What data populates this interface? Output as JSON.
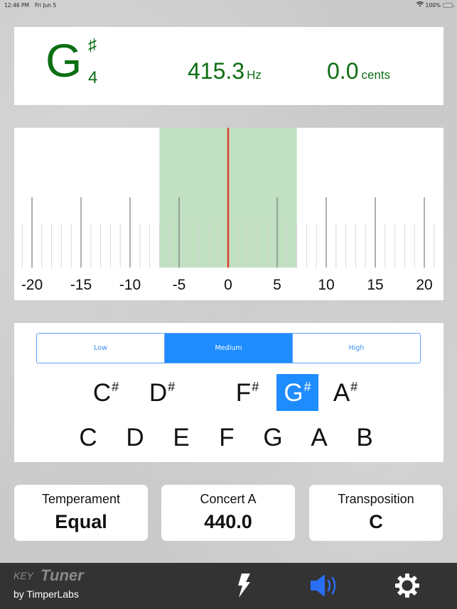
{
  "status_bar": {
    "time": "12:46 PM",
    "date": "Fri Jun 5",
    "battery": "100%",
    "icons": [
      "wifi-icon",
      "battery-charging-icon"
    ]
  },
  "reading": {
    "note_letter": "G",
    "note_accidental": "♯",
    "note_octave": "4",
    "frequency": "415.3",
    "frequency_unit": "Hz",
    "cents": "0.0",
    "cents_unit": "cents",
    "color": "#0c6e12"
  },
  "meter": {
    "min": -21,
    "max": 21,
    "labels": [
      "-20",
      "-15",
      "-10",
      "-5",
      "0",
      "5",
      "10",
      "15",
      "20"
    ],
    "label_values": [
      -20,
      -15,
      -10,
      -5,
      0,
      5,
      10,
      15,
      20
    ],
    "in_tune_range": [
      -7,
      7
    ],
    "needle_value": 0.0,
    "in_tune_color": "#c2e0c2",
    "needle_color": "#d9412e"
  },
  "sensitivity": {
    "options": [
      "Low",
      "Medium",
      "High"
    ],
    "selected": "Medium"
  },
  "keys": {
    "sharps": [
      {
        "letter": "C",
        "acc": "#"
      },
      {
        "letter": "D",
        "acc": "#"
      },
      {
        "letter": "F",
        "acc": "#"
      },
      {
        "letter": "G",
        "acc": "#",
        "selected": true
      },
      {
        "letter": "A",
        "acc": "#"
      }
    ],
    "naturals": [
      "C",
      "D",
      "E",
      "F",
      "G",
      "A",
      "B"
    ]
  },
  "settings": [
    {
      "label": "Temperament",
      "value": "Equal"
    },
    {
      "label": "Concert A",
      "value": "440.0"
    },
    {
      "label": "Transposition",
      "value": "C"
    }
  ],
  "toolbar": {
    "brand_key": "KEY",
    "brand_tuner": "Tuner",
    "brand_by": "by TimperLabs",
    "icons": [
      "lightning-icon",
      "speaker-icon",
      "gear-icon"
    ],
    "speaker_color": "#2a6ef5"
  }
}
